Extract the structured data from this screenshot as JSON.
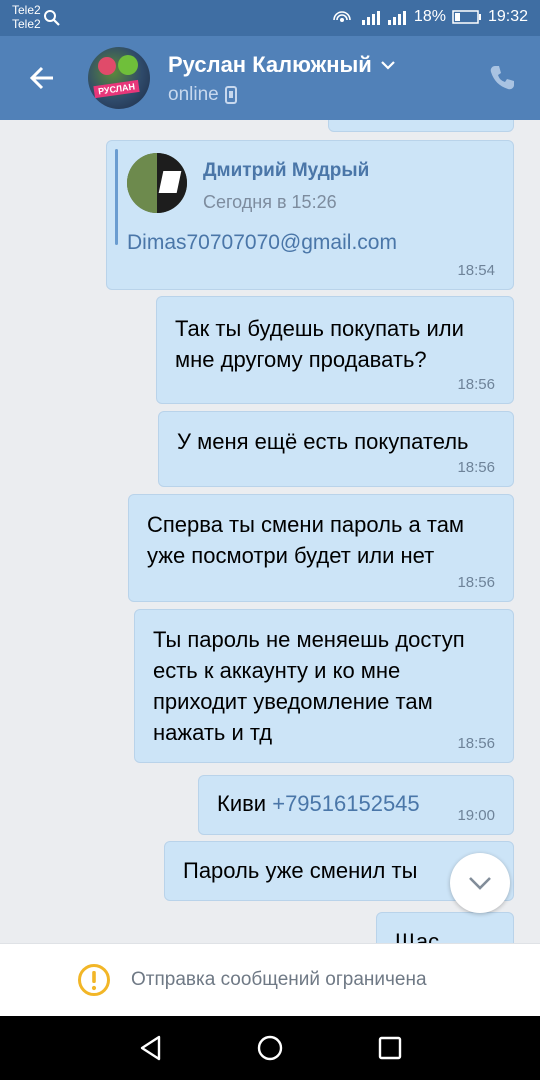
{
  "status_bar": {
    "carrier_1": "Tele2",
    "carrier_2": "Tele2",
    "battery": "18%",
    "time": "19:32"
  },
  "header": {
    "name": "Руслан Калюжный",
    "status": "online",
    "avatar_label": "РУСЛАН"
  },
  "forwarded": {
    "author": "Дмитрий Мудрый",
    "date": "Сегодня в 15:26",
    "email": "Dimas70707070@gmail.com",
    "time": "18:54"
  },
  "messages": [
    {
      "text": "Так ты будешь покупать или\nмне другому продавать?",
      "time": "18:56"
    },
    {
      "text": "У меня ещё есть покупатель",
      "time": "18:56"
    },
    {
      "text": "Сперва ты смени пароль а там\nуже посмотри  будет или нет",
      "time": "18:56"
    },
    {
      "text": "Ты пароль не меняешь доступ\nесть к аккаунту и ко мне\nприходит уведомление там\nнажать и тд",
      "time": "18:56"
    },
    {
      "text": "Киви",
      "phone": "+79516152545",
      "time": "19:00"
    },
    {
      "text": "Пароль уже сменил ты"
    },
    {
      "text": "Щас"
    }
  ],
  "footer": {
    "notice": "Отправка сообщений ограничена"
  },
  "colors": {
    "header_bg": "#5181b8",
    "status_bg": "#3f6ea3",
    "bubble_bg": "#cce4f7",
    "link": "#4a76a8",
    "warning": "#f2b627"
  }
}
